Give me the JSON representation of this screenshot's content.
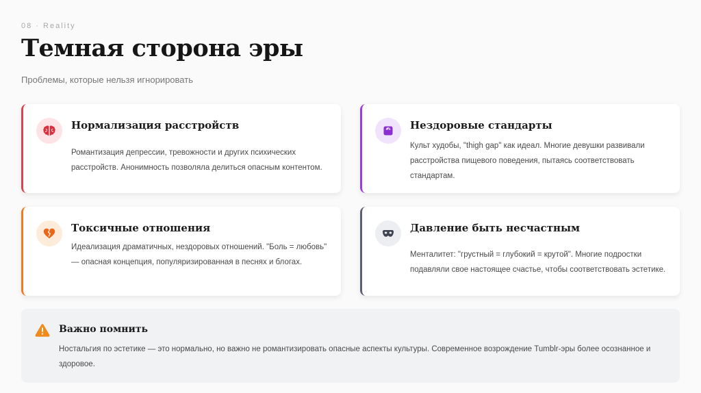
{
  "header": {
    "eyebrow": "08 · Reality",
    "title": "Темная сторона эры",
    "subtitle": "Проблемы, которые нельзя игнорировать"
  },
  "cards": [
    {
      "icon": "brain-icon",
      "accent": "#e0414f",
      "title": "Нормализация расстройств",
      "text": "Романтизация депрессии, тревожности и других психических расстройств. Анонимность позволяла делиться опасным контентом."
    },
    {
      "icon": "weight-scale-icon",
      "accent": "#9b3fd6",
      "title": "Нездоровые стандарты",
      "text": "Культ худобы, \"thigh gap\" как идеал. Многие девушки развивали расстройства пищевого поведения, пытаясь соответствовать стандартам."
    },
    {
      "icon": "broken-heart-icon",
      "accent": "#f07a1d",
      "title": "Токсичные отношения",
      "text": "Идеализация драматичных, нездоровых отношений. \"Боль = любовь\" — опасная концепция, популяризированная в песнях и блогах."
    },
    {
      "icon": "mask-icon",
      "accent": "#5a6070",
      "title": "Давление быть несчастным",
      "text": "Менталитет: \"грустный = глубокий = крутой\". Многие подростки подавляли свое настоящее счастье, чтобы соответствовать эстетике."
    }
  ],
  "notice": {
    "icon": "warning-icon",
    "title": "Важно помнить",
    "text": "Ностальгия по эстетике — это нормально, но важно не романтизировать опасные аспекты культуры. Современное возрождение Tumblr-эры более осознанное и здоровое."
  }
}
